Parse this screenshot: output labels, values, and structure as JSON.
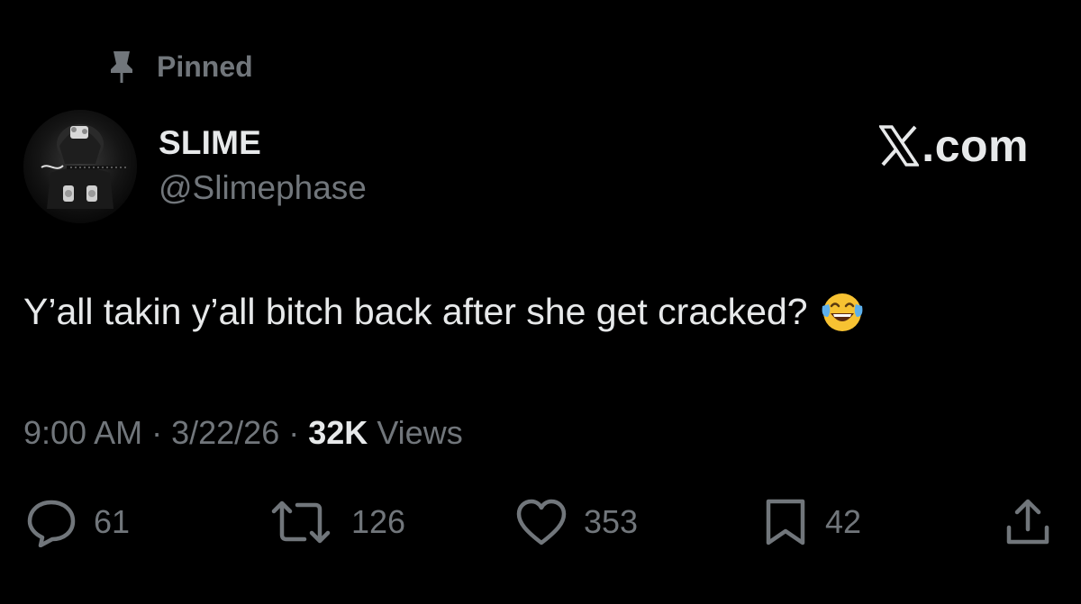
{
  "pinned": {
    "icon": "pin-icon",
    "label": "Pinned"
  },
  "author": {
    "avatar": "profile-avatar",
    "display_name": "SLIME",
    "handle": "@Slimephase"
  },
  "brand": {
    "icon": "x-logo-icon",
    "text": ".com"
  },
  "tweet": {
    "text": "Y’all takin y’all bitch back after she get cracked?",
    "emoji": "face-with-tears-of-joy"
  },
  "meta": {
    "time": "9:00 AM",
    "separator": "·",
    "date": "3/22/26",
    "views_count": "32K",
    "views_label": "Views"
  },
  "actions": {
    "reply": {
      "icon": "reply-icon",
      "count": "61"
    },
    "retweet": {
      "icon": "retweet-icon",
      "count": "126"
    },
    "like": {
      "icon": "heart-icon",
      "count": "353"
    },
    "bookmark": {
      "icon": "bookmark-icon",
      "count": "42"
    },
    "share": {
      "icon": "share-icon"
    }
  },
  "colors": {
    "background": "#000000",
    "primary_text": "#e7e9ea",
    "secondary_text": "#71767b",
    "emoji_yellow": "#f7c232"
  }
}
